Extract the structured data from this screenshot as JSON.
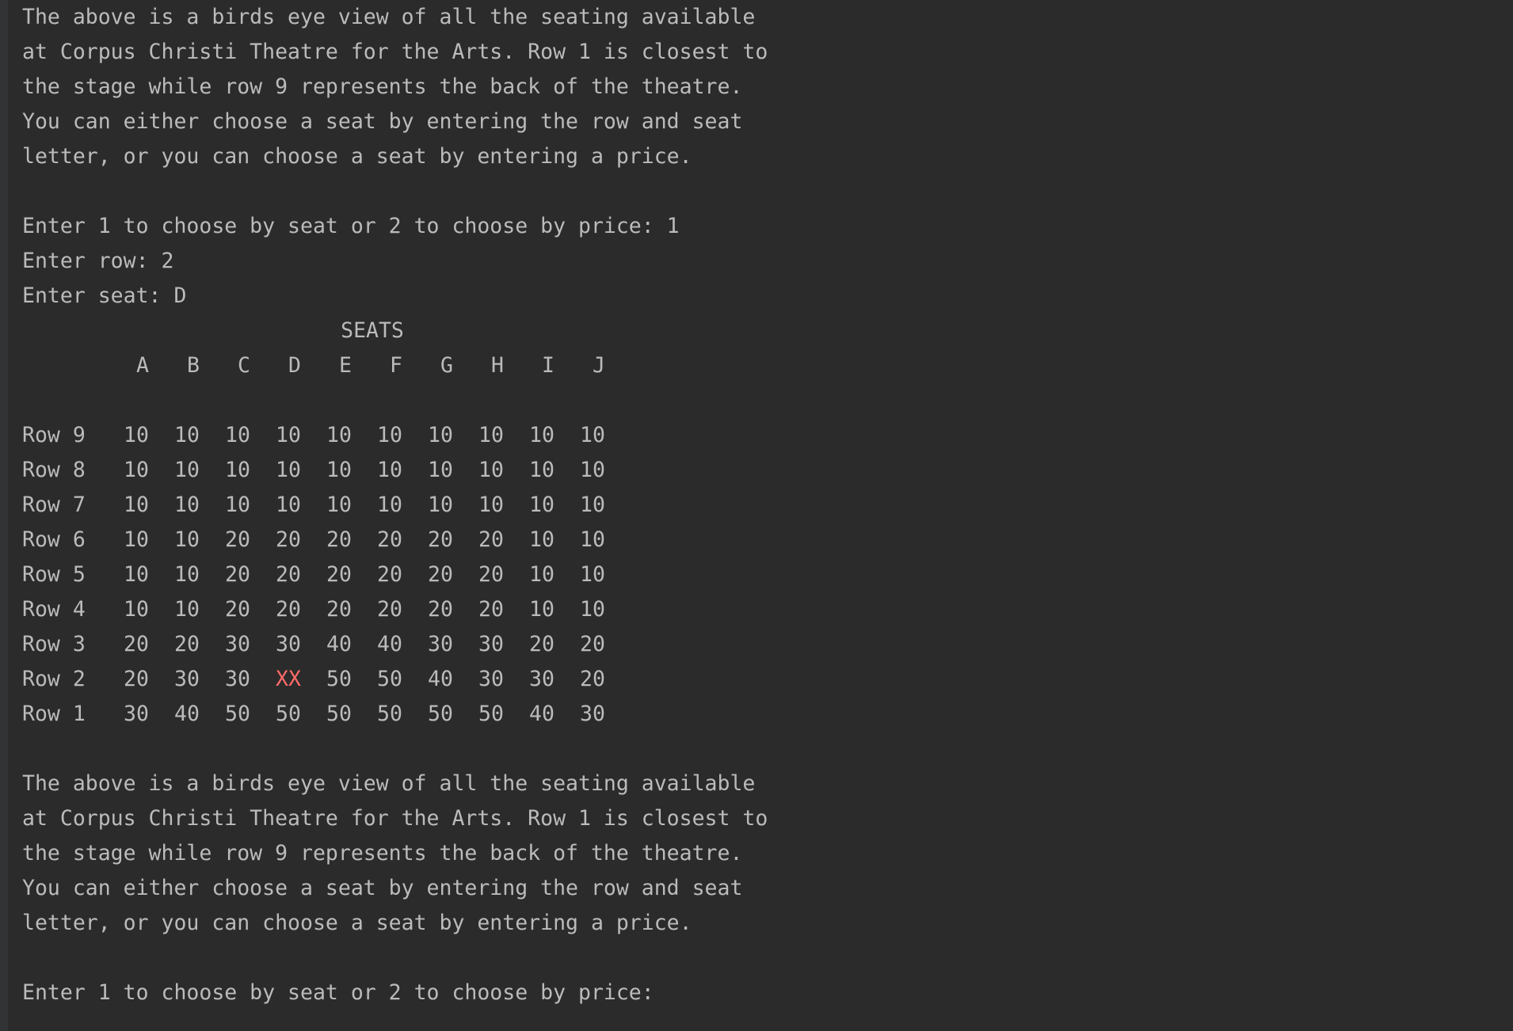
{
  "colors": {
    "background": "#2b2b2b",
    "text": "#bbbbbb",
    "taken": "#ff6b68",
    "gutter": "#313335"
  },
  "intro_1": [
    "The above is a birds eye view of all the seating available",
    "at Corpus Christi Theatre for the Arts. Row 1 is closest to",
    "the stage while row 9 represents the back of the theatre.",
    "You can either choose a seat by entering the row and seat",
    "letter, or you can choose a seat by entering a price."
  ],
  "prompt_mode_1": {
    "text": "Enter 1 to choose by seat or 2 to choose by price: ",
    "value": "1"
  },
  "prompt_row": {
    "text": "Enter row: ",
    "value": "2"
  },
  "prompt_seat": {
    "text": "Enter seat: ",
    "value": "D"
  },
  "seat_map": {
    "title": "SEATS",
    "columns": [
      "A",
      "B",
      "C",
      "D",
      "E",
      "F",
      "G",
      "H",
      "I",
      "J"
    ],
    "rows": [
      {
        "label": "Row 9",
        "cells": [
          "10",
          "10",
          "10",
          "10",
          "10",
          "10",
          "10",
          "10",
          "10",
          "10"
        ]
      },
      {
        "label": "Row 8",
        "cells": [
          "10",
          "10",
          "10",
          "10",
          "10",
          "10",
          "10",
          "10",
          "10",
          "10"
        ]
      },
      {
        "label": "Row 7",
        "cells": [
          "10",
          "10",
          "10",
          "10",
          "10",
          "10",
          "10",
          "10",
          "10",
          "10"
        ]
      },
      {
        "label": "Row 6",
        "cells": [
          "10",
          "10",
          "20",
          "20",
          "20",
          "20",
          "20",
          "20",
          "10",
          "10"
        ]
      },
      {
        "label": "Row 5",
        "cells": [
          "10",
          "10",
          "20",
          "20",
          "20",
          "20",
          "20",
          "20",
          "10",
          "10"
        ]
      },
      {
        "label": "Row 4",
        "cells": [
          "10",
          "10",
          "20",
          "20",
          "20",
          "20",
          "20",
          "20",
          "10",
          "10"
        ]
      },
      {
        "label": "Row 3",
        "cells": [
          "20",
          "20",
          "30",
          "30",
          "40",
          "40",
          "30",
          "30",
          "20",
          "20"
        ]
      },
      {
        "label": "Row 2",
        "cells": [
          "20",
          "30",
          "30",
          "XX",
          "50",
          "50",
          "40",
          "30",
          "30",
          "20"
        ]
      },
      {
        "label": "Row 1",
        "cells": [
          "30",
          "40",
          "50",
          "50",
          "50",
          "50",
          "50",
          "50",
          "40",
          "30"
        ]
      }
    ]
  },
  "intro_2": [
    "The above is a birds eye view of all the seating available",
    "at Corpus Christi Theatre for the Arts. Row 1 is closest to",
    "the stage while row 9 represents the back of the theatre.",
    "You can either choose a seat by entering the row and seat",
    "letter, or you can choose a seat by entering a price."
  ],
  "prompt_mode_2": {
    "text": "Enter 1 to choose by seat or 2 to choose by price: ",
    "value": ""
  }
}
